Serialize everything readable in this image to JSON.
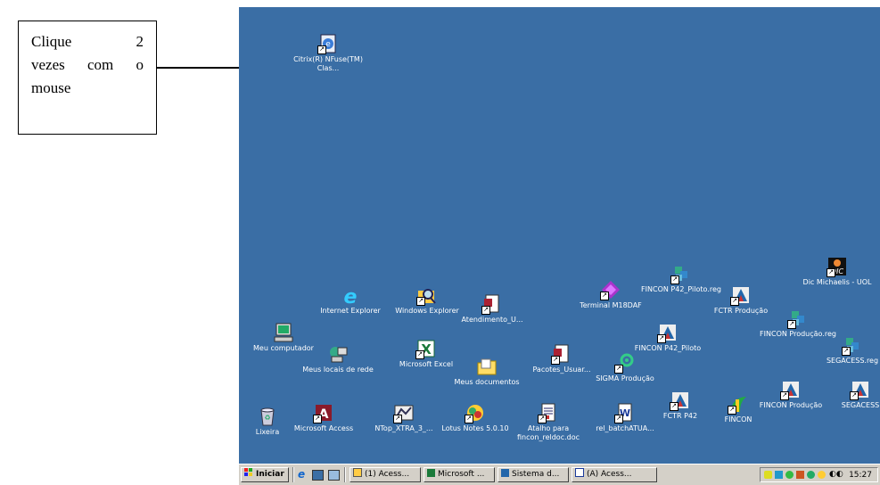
{
  "callout": {
    "line1": "Clique 2",
    "line2": "vezes com o",
    "line3": "mouse"
  },
  "desktop": {
    "background": "#3a6ea5",
    "icons": [
      {
        "label": "Citrix(R) NFuse(TM) Clas...",
        "icon": "citrix-icon"
      },
      {
        "label": "Dic Michaelis - UOL",
        "icon": "dictionary-icon"
      },
      {
        "label": "FINCON P42_Piloto.reg",
        "icon": "registry-icon"
      },
      {
        "label": "FCTR Produção",
        "icon": "fctr-icon"
      },
      {
        "label": "Internet Explorer",
        "icon": "internet-explorer-icon"
      },
      {
        "label": "Windows Explorer",
        "icon": "windows-explorer-icon"
      },
      {
        "label": "Atendimento_U...",
        "icon": "document-icon"
      },
      {
        "label": "Terminal M18DAF",
        "icon": "terminal-icon"
      },
      {
        "label": "FINCON Produção.reg",
        "icon": "registry-icon"
      },
      {
        "label": "Meu computador",
        "icon": "computer-icon"
      },
      {
        "label": "FINCON P42_Piloto",
        "icon": "fincon-icon"
      },
      {
        "label": "SEGACESS.reg",
        "icon": "registry-icon"
      },
      {
        "label": "Meus locais de rede",
        "icon": "network-icon"
      },
      {
        "label": "Microsoft Excel",
        "icon": "excel-icon"
      },
      {
        "label": "Meus documentos",
        "icon": "folder-icon"
      },
      {
        "label": "Pacotes_Usuar...",
        "icon": "document-icon"
      },
      {
        "label": "SIGMA Produção",
        "icon": "sigma-icon"
      },
      {
        "label": "FCTR P42",
        "icon": "fctr-icon"
      },
      {
        "label": "FINCON",
        "icon": "fincon-green-icon"
      },
      {
        "label": "FINCON Produção",
        "icon": "fincon-icon"
      },
      {
        "label": "SEGACESS",
        "icon": "fincon-icon"
      },
      {
        "label": "Lixeira",
        "icon": "recycle-bin-icon"
      },
      {
        "label": "Microsoft Access",
        "icon": "access-icon"
      },
      {
        "label": "NTop_XTRA_3_...",
        "icon": "ntop-icon"
      },
      {
        "label": "Lotus Notes 5.0.10",
        "icon": "lotus-notes-icon"
      },
      {
        "label": "Atalho para fincon_reldoc.doc",
        "icon": "shortcut-doc-icon"
      },
      {
        "label": "rel_batchATUA...",
        "icon": "word-doc-icon"
      }
    ]
  },
  "taskbar": {
    "start_label": "Iniciar",
    "tasks": [
      {
        "label": "(1) Acess...",
        "icon": "search-icon"
      },
      {
        "label": "Microsoft ...",
        "icon": "excel-icon"
      },
      {
        "label": "Sistema d...",
        "icon": "app-icon"
      },
      {
        "label": "(A) Acess...",
        "icon": "word-icon"
      }
    ],
    "clock": "15:27"
  }
}
